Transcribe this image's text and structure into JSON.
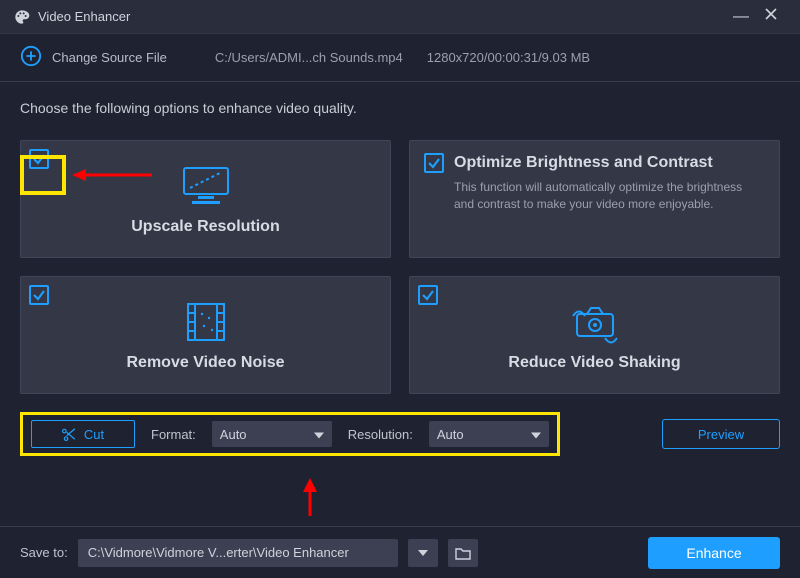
{
  "titlebar": {
    "app_name": "Video Enhancer"
  },
  "sourcebar": {
    "change_label": "Change Source File",
    "file_path": "C:/Users/ADMI...ch Sounds.mp4",
    "file_meta": "1280x720/00:00:31/9.03 MB"
  },
  "instruction": "Choose the following options to enhance video quality.",
  "cards": {
    "upscale": {
      "title": "Upscale Resolution",
      "checked": true
    },
    "brightness": {
      "title": "Optimize Brightness and Contrast",
      "desc": "This function will automatically optimize the brightness and contrast to make your video more enjoyable.",
      "checked": true
    },
    "noise": {
      "title": "Remove Video Noise",
      "checked": true
    },
    "shaking": {
      "title": "Reduce Video Shaking",
      "checked": true
    }
  },
  "controls": {
    "cut_label": "Cut",
    "format_label": "Format:",
    "format_value": "Auto",
    "resolution_label": "Resolution:",
    "resolution_value": "Auto",
    "preview_label": "Preview"
  },
  "footer": {
    "saveto_label": "Save to:",
    "save_path": "C:\\Vidmore\\Vidmore V...erter\\Video Enhancer",
    "enhance_label": "Enhance"
  },
  "colors": {
    "accent": "#1e9fff",
    "annotate": "#ffe600",
    "arrow": "#ff0000"
  }
}
